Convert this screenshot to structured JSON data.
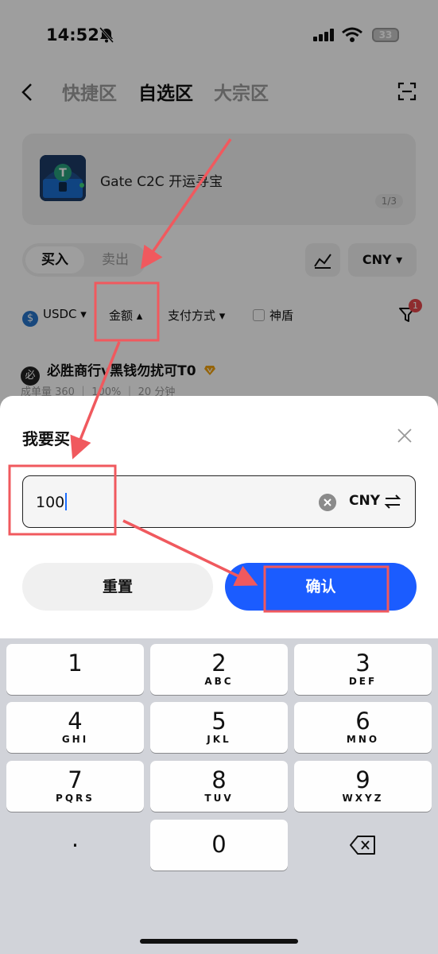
{
  "status_bar": {
    "time": "14:52",
    "battery": "33"
  },
  "nav": {
    "tabs": [
      "快捷区",
      "自选区",
      "大宗区"
    ],
    "active_tab": "自选区"
  },
  "banner": {
    "title": "Gate C2C 开运寻宝",
    "pager": "1/3"
  },
  "trade_toggle": {
    "buy": "买入",
    "sell": "卖出"
  },
  "currency_selector": "CNY ▾",
  "filters": {
    "coin": "USDC ▾",
    "amount": "金额 ▴",
    "payment": "支付方式 ▾",
    "shield": "神盾",
    "filter_badge": "1"
  },
  "merchant": {
    "avatar": "必",
    "name": "必胜商行v黑钱勿扰可T0",
    "stats": "成单量 360 ｜ 100% ｜ 20 分钟"
  },
  "sheet": {
    "title": "我要买",
    "amount_value": "100",
    "currency": "CNY",
    "reset_label": "重置",
    "confirm_label": "确认"
  },
  "keyboard": {
    "keys": [
      {
        "num": "1",
        "letters": ""
      },
      {
        "num": "2",
        "letters": "ABC"
      },
      {
        "num": "3",
        "letters": "DEF"
      },
      {
        "num": "4",
        "letters": "GHI"
      },
      {
        "num": "5",
        "letters": "JKL"
      },
      {
        "num": "6",
        "letters": "MNO"
      },
      {
        "num": "7",
        "letters": "PQRS"
      },
      {
        "num": "8",
        "letters": "TUV"
      },
      {
        "num": "9",
        "letters": "WXYZ"
      },
      {
        "num": ".",
        "letters": ""
      },
      {
        "num": "0",
        "letters": ""
      }
    ]
  },
  "colors": {
    "accent": "#1b5cff",
    "annotation": "#f0595e",
    "badge": "#e5484d"
  }
}
